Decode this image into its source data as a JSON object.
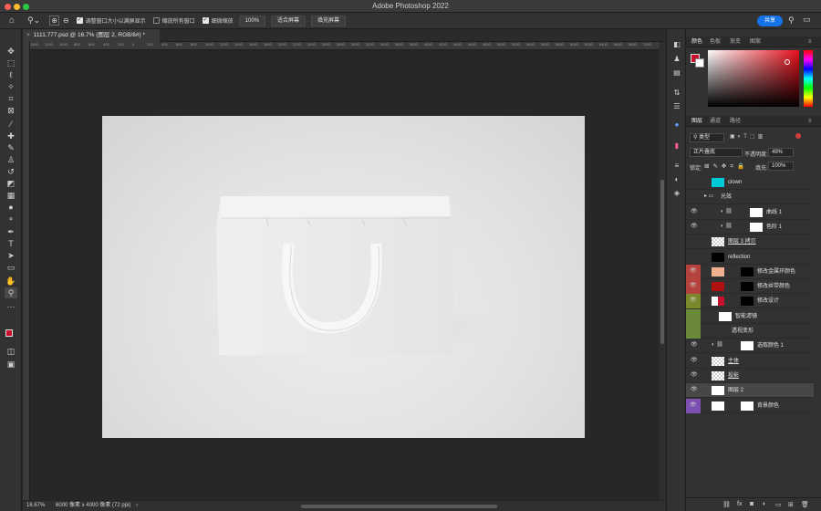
{
  "window": {
    "title": "Adobe Photoshop 2022"
  },
  "options_bar": {
    "checkbox1_label": "调整窗口大小以满屏显示",
    "checkbox2_label": "缩放所有窗口",
    "checkbox3_label": "细微缩放",
    "zoom_value": "100%",
    "fit_screen": "适合屏幕",
    "fill_screen": "填充屏幕",
    "share": "共享"
  },
  "document": {
    "tab_title": "1111.777.psd @ 16.7% (图层 2, RGB/8#) *",
    "zoom": "16.67%",
    "size": "6000 像素 x 4000 像素 (72 ppi)"
  },
  "ruler_ticks": [
    "1400",
    "1200",
    "1000",
    "800",
    "600",
    "400",
    "200",
    "0",
    "200",
    "400",
    "600",
    "800",
    "1000",
    "1200",
    "1400",
    "1600",
    "1800",
    "2000",
    "2200",
    "2400",
    "2600",
    "2800",
    "3000",
    "3200",
    "3400",
    "3600",
    "3800",
    "4000",
    "4200",
    "4400",
    "4600",
    "4800",
    "5000",
    "5200",
    "5400",
    "5600",
    "5800",
    "6000",
    "6200",
    "6400",
    "6600",
    "6800",
    "7000",
    "7200",
    "7400"
  ],
  "color_panel": {
    "tabs": [
      "颜色",
      "色板",
      "渐变",
      "图案"
    ],
    "foreground": "#c8102e",
    "background": "#ffffff"
  },
  "layers_panel": {
    "tabs": [
      "图层",
      "通道",
      "路径"
    ],
    "filter_kind": "类型",
    "blend_mode": "正片叠底",
    "opacity_label": "不透明度:",
    "opacity": "49%",
    "lock_label": "锁定:",
    "fill_label": "填充:",
    "fill": "100%",
    "layers": [
      {
        "name": "clown",
        "color": ""
      },
      {
        "name": "光效",
        "color": ""
      },
      {
        "name": "曲线 1",
        "color": ""
      },
      {
        "name": "色阶 1",
        "color": ""
      },
      {
        "name": "图层 3 拷贝",
        "color": ""
      },
      {
        "name": "reflection",
        "color": ""
      },
      {
        "name": "修改金属环颜色",
        "color": "#b5423c"
      },
      {
        "name": "修改丝带颜色",
        "color": "#b5423c"
      },
      {
        "name": "修改设计",
        "color": "#7a8a2a"
      },
      {
        "name": "智能滤镜",
        "color": "#6a8a3a"
      },
      {
        "name": "透视变形",
        "color": "#6a8a3a"
      },
      {
        "name": "选取颜色 1",
        "color": ""
      },
      {
        "name": "主体",
        "color": ""
      },
      {
        "name": "投影",
        "color": ""
      },
      {
        "name": "图层 2",
        "color": ""
      },
      {
        "name": "背景颜色",
        "color": "#7c4fb0"
      }
    ]
  }
}
